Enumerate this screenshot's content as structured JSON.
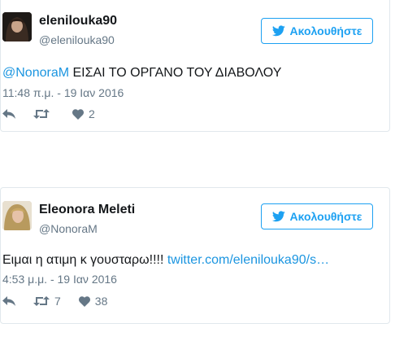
{
  "tweets": [
    {
      "display_name": "elenilouka90",
      "handle": "@elenilouka90",
      "follow_label": "Ακολουθήστε",
      "mention": "@NonoraM",
      "text": " ΕΙΣΑΙ ΤΟ ΟΡΓΑΝΟ ΤΟΥ ΔΙΑΒΟΛΟΥ",
      "timestamp": "11:48 π.μ. - 19 Ιαν 2016",
      "retweets": "",
      "likes": "2"
    },
    {
      "display_name": "Eleonora Meleti",
      "handle": "@NonoraM",
      "follow_label": "Ακολουθήστε",
      "text": "Ειμαι η ατιμη κ γουσταρω!!!! ",
      "link": "twitter.com/elenilouka90/s…",
      "timestamp": "4:53 μ.μ. - 19 Ιαν 2016",
      "retweets": "7",
      "likes": "38"
    }
  ],
  "colors": {
    "brand_blue": "#1da1f2",
    "link_blue": "#1b95e0",
    "secondary_text": "#657786",
    "border": "#e1e8ed"
  },
  "icons": {
    "follow": "twitter-bird-icon",
    "reply": "reply-icon",
    "retweet": "retweet-icon",
    "like": "heart-icon"
  }
}
